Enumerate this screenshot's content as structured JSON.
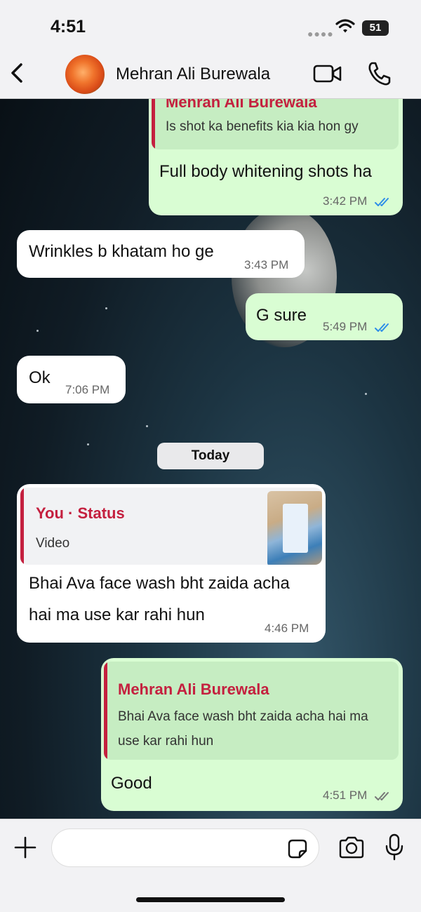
{
  "status_bar": {
    "time": "4:51",
    "battery": "51"
  },
  "header": {
    "contact_name": "Mehran Ali Burewala"
  },
  "messages": [
    {
      "direction": "out",
      "quote_author": "Mehran Ali Burewala",
      "quote_text": "Is shot ka benefits kia kia hon gy",
      "text": "Full body whitening shots ha",
      "time": "3:42 PM",
      "status": "read"
    },
    {
      "direction": "in",
      "text": "Wrinkles b khatam ho ge",
      "time": "3:43 PM"
    },
    {
      "direction": "out",
      "text": "G sure",
      "time": "5:49 PM",
      "status": "read"
    },
    {
      "direction": "in",
      "text": "Ok",
      "time": "7:06 PM"
    },
    {
      "direction": "in",
      "quote_author": "You · Status",
      "quote_text": "Video",
      "text_line1": "Bhai Ava face wash bht zaida acha",
      "text_line2": "hai ma use kar rahi hun",
      "time": "4:46 PM"
    },
    {
      "direction": "out",
      "quote_author": "Mehran Ali Burewala",
      "quote_text_line1": "Bhai Ava face wash bht zaida acha hai ma",
      "quote_text_line2": "use kar rahi hun",
      "text": "Good",
      "time": "4:51 PM",
      "status": "delivered"
    }
  ],
  "date_separator": "Today",
  "composer": {
    "placeholder": ""
  },
  "colors": {
    "outgoing": "#d9fdd3",
    "incoming": "#ffffff",
    "quote_accent": "#c4203f",
    "read_tick": "#2e8ee8"
  },
  "icons": [
    "back-chevron-icon",
    "video-camera-icon",
    "phone-icon",
    "plus-icon",
    "sticker-icon",
    "camera-icon",
    "microphone-icon",
    "double-check-icon"
  ]
}
